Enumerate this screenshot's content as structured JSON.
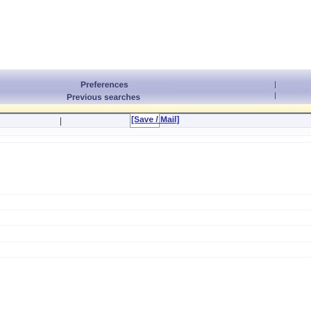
{
  "nav": {
    "preferences_label": "Preferences",
    "previous_searches_label": "Previous searches",
    "separator": "|"
  },
  "toolbar": {
    "separator": "|",
    "save_mail_label": "[Save / Mail]"
  },
  "colors": {
    "nav_band": "#b2b5d8",
    "nav_text": "#3a3a6e",
    "strip": "#fdf4c6",
    "rule": "#6a6d7a",
    "link": "#2a2fa8"
  }
}
